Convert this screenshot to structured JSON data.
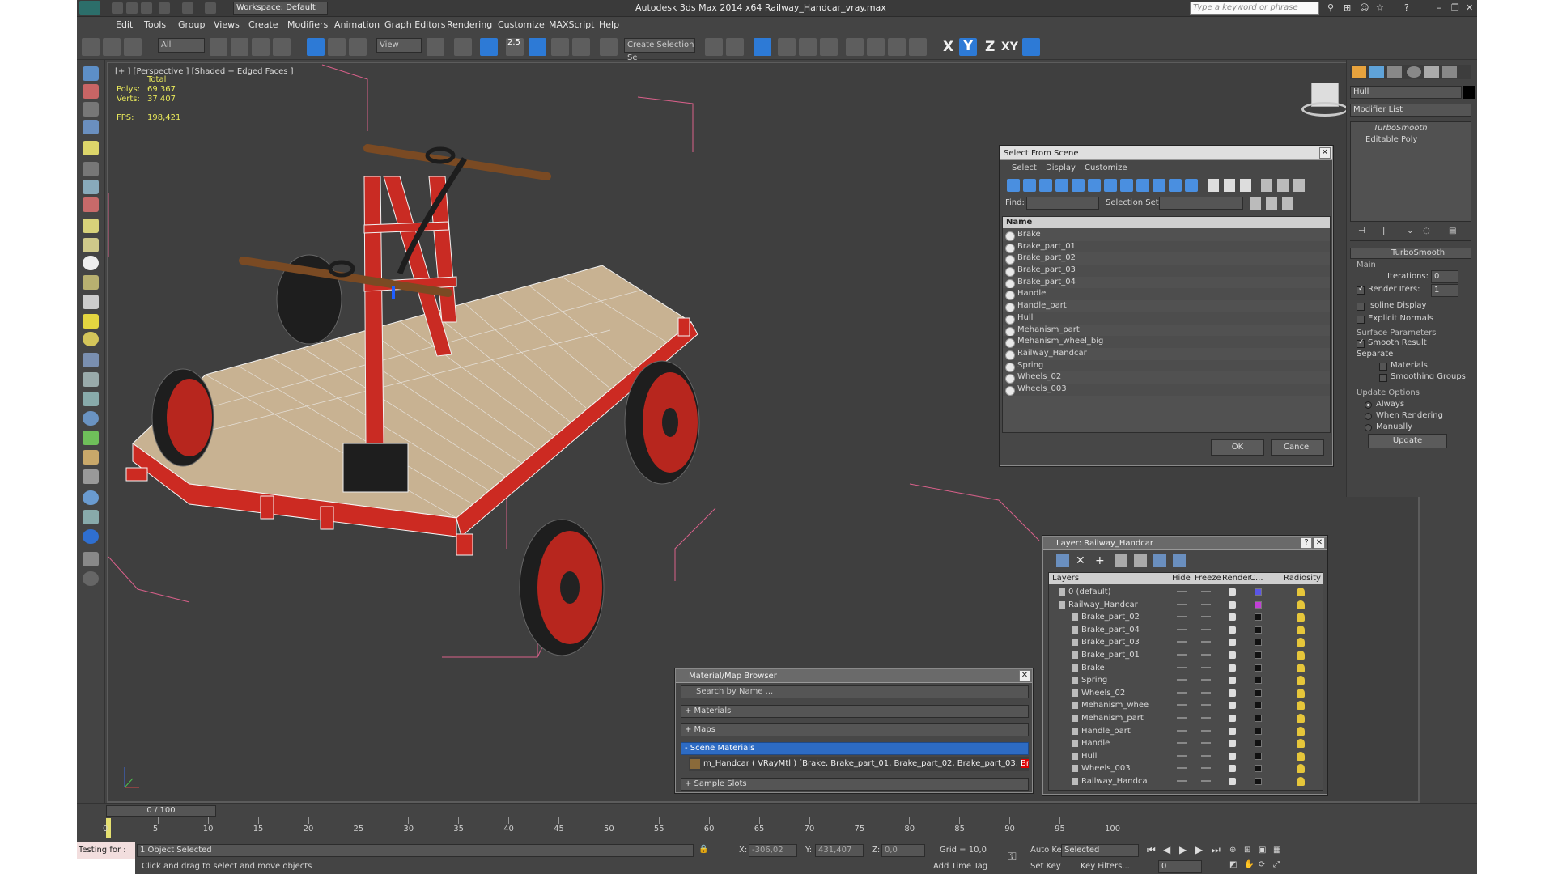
{
  "app": {
    "title": "Autodesk 3ds Max  2014 x64     Railway_Handcar_vray.max",
    "workspace": "Workspace: Default",
    "search_placeholder": "Type a keyword or phrase"
  },
  "menu": [
    "Edit",
    "Tools",
    "Group",
    "Views",
    "Create",
    "Modifiers",
    "Animation",
    "Graph Editors",
    "Rendering",
    "Customize",
    "MAXScript",
    "Help"
  ],
  "toolbar": {
    "filter": "All",
    "refcoord": "View",
    "angle_snap": "2.5",
    "selection_set": "Create Selection Se",
    "axes": [
      "X",
      "Y",
      "Z",
      "XY"
    ]
  },
  "viewport": {
    "label": "[+ ] [Perspective ] [Shaded + Edged Faces ]",
    "stats": {
      "header": "Total",
      "polys_label": "Polys:",
      "polys": "69 367",
      "verts_label": "Verts:",
      "verts": "37 407",
      "fps_label": "FPS:",
      "fps": "198,421"
    }
  },
  "command_panel": {
    "object_name": "Hull",
    "modifier_list": "Modifier List",
    "stack": [
      "TurboSmooth",
      "Editable Poly"
    ],
    "rollout": "TurboSmooth",
    "main": "Main",
    "iterations_label": "Iterations:",
    "iterations": "0",
    "render_iters_label": "Render Iters:",
    "render_iters": "1",
    "isoline": "Isoline Display",
    "explicit_normals": "Explicit Normals",
    "surface_params": "Surface Parameters",
    "smooth_result": "Smooth Result",
    "separate": "Separate",
    "materials": "Materials",
    "smoothing_groups": "Smoothing Groups",
    "update_options": "Update Options",
    "always": "Always",
    "when_rendering": "When Rendering",
    "manually": "Manually",
    "update": "Update"
  },
  "select_dialog": {
    "title": "Select From Scene",
    "menu": [
      "Select",
      "Display",
      "Customize"
    ],
    "find_label": "Find:",
    "selset_label": "Selection Set:",
    "column": "Name",
    "items": [
      "Brake",
      "Brake_part_01",
      "Brake_part_02",
      "Brake_part_03",
      "Brake_part_04",
      "Handle",
      "Handle_part",
      "Hull",
      "Mehanism_part",
      "Mehanism_wheel_big",
      "Railway_Handcar",
      "Spring",
      "Wheels_02",
      "Wheels_003"
    ],
    "ok": "OK",
    "cancel": "Cancel"
  },
  "layer_dialog": {
    "title": "Layer: Railway_Handcar",
    "columns": [
      "Layers",
      "Hide",
      "Freeze",
      "Render",
      "C...",
      "Radiosity"
    ],
    "layers": [
      "0 (default)",
      "Railway_Handcar"
    ],
    "objects": [
      "Brake_part_02",
      "Brake_part_04",
      "Brake_part_03",
      "Brake_part_01",
      "Brake",
      "Spring",
      "Wheels_02",
      "Mehanism_whee",
      "Mehanism_part",
      "Handle_part",
      "Handle",
      "Hull",
      "Wheels_003",
      "Railway_Handca"
    ],
    "colors": {
      "default": "#5a55e6",
      "handcar": "#c23fd6"
    }
  },
  "material_browser": {
    "title": "Material/Map Browser",
    "search": "Search by Name ...",
    "groups": [
      "+ Materials",
      "+ Maps",
      "- Scene Materials",
      "+ Sample Slots"
    ],
    "material_prefix": "m_Handcar  ( VRayMtl )  [Brake, Brake_part_01, Brake_part_02, Brake_part_03, ",
    "material_highlight": "Br..."
  },
  "timeline": {
    "frame": "0 / 100",
    "ticks": [
      "0",
      "5",
      "10",
      "15",
      "20",
      "25",
      "30",
      "35",
      "40",
      "45",
      "50",
      "55",
      "60",
      "65",
      "70",
      "75",
      "80",
      "85",
      "90",
      "95",
      "100"
    ]
  },
  "status": {
    "maxscript": "Testing for :",
    "selection": "1 Object Selected",
    "prompt": "Click and drag to select and move objects",
    "x_label": "X:",
    "x": "-306,02",
    "y_label": "Y:",
    "y": "431,407",
    "z_label": "Z:",
    "z": "0,0",
    "grid": "Grid = 10,0",
    "add_time_tag": "Add Time Tag",
    "auto_key": "Auto Key",
    "set_key": "Set Key",
    "selected": "Selected",
    "key_filters": "Key Filters...",
    "frame_field": "0"
  }
}
